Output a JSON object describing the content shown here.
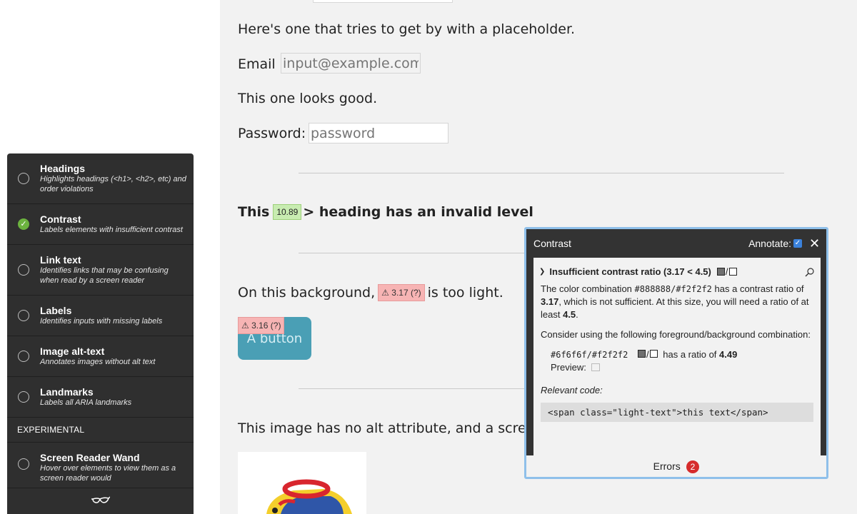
{
  "page": {
    "placeholder_intro": "Here's one that tries to get by with a placeholder.",
    "email_label": "Email",
    "email_placeholder": "input@example.com",
    "looks_good": "This one looks good.",
    "password_label": "Password:",
    "password_placeholder": "password",
    "heading_before": "This",
    "heading_badge": "10.89",
    "heading_after": "> heading has an invalid level",
    "bg_before": "On this background,",
    "bg_badge": "⚠ 3.17 (?)",
    "bg_after": "is too light.",
    "button_badge": "⚠ 3.16 (?)",
    "button_label": "A button",
    "image_text": "This image has no alt attribute, and a screen-reader"
  },
  "sidebar": {
    "items": [
      {
        "title": "Headings",
        "desc": "Highlights headings (<h1>, <h2>, etc) and order violations",
        "checked": false
      },
      {
        "title": "Contrast",
        "desc": "Labels elements with insufficient contrast",
        "checked": true
      },
      {
        "title": "Link text",
        "desc": "Identifies links that may be confusing when read by a screen reader",
        "checked": false
      },
      {
        "title": "Labels",
        "desc": "Identifies inputs with missing labels",
        "checked": false
      },
      {
        "title": "Image alt-text",
        "desc": "Annotates images without alt text",
        "checked": false
      },
      {
        "title": "Landmarks",
        "desc": "Labels all ARIA landmarks",
        "checked": false
      }
    ],
    "section_label": "EXPERIMENTAL",
    "wand": {
      "title": "Screen Reader Wand",
      "desc": "Hover over elements to view them as a screen reader would",
      "checked": false
    },
    "footer_icon": "glasses-icon"
  },
  "panel": {
    "title": "Contrast",
    "annotate_label": "Annotate:",
    "annotate_checked": true,
    "error_title": "Insufficient contrast ratio (3.17 < 4.5)",
    "desc_1": "The color combination",
    "desc_colors": "#888888/#f2f2f2",
    "desc_2": "has a contrast ratio of",
    "desc_ratio": "3.17",
    "desc_3": ", which is not sufficient. At this size, you will need a ratio of at least",
    "desc_min": "4.5",
    "consider": "Consider using the following foreground/background combination:",
    "suggest_colors": "#6f6f6f/#f2f2f2",
    "suggest_ratio_label": "has a ratio of",
    "suggest_ratio": "4.49",
    "preview_label": "Preview:",
    "relevant_code_label": "Relevant code:",
    "code": "<span class=\"light-text\">this text</span>",
    "errors_label": "Errors",
    "errors_count": "2"
  },
  "colors": {
    "sidebar_bg": "#2f2f2f",
    "page_bg": "#f2f2f2",
    "button_bg": "#4a9fb5",
    "check_green": "#6cb33f",
    "error_red": "#d62b2b",
    "panel_border": "#8fc0ea"
  }
}
